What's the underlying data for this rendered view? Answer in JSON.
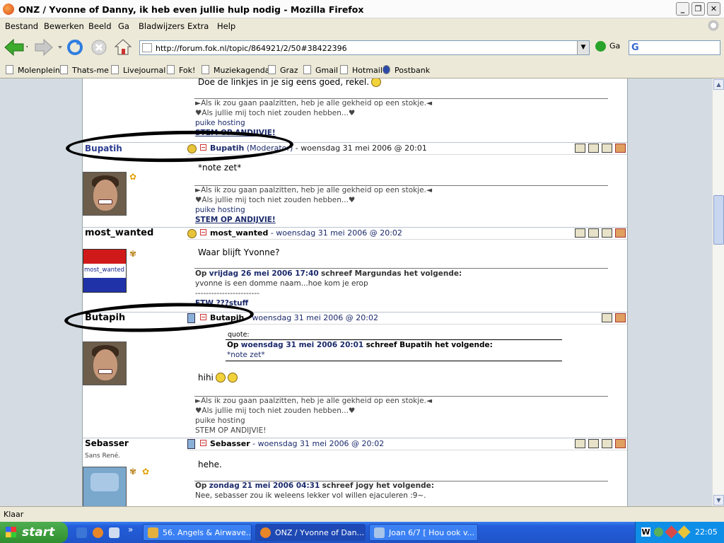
{
  "window": {
    "title": "ONZ / Yvonne of Danny, ik heb even jullie hulp nodig - Mozilla Firefox",
    "min": "_",
    "max": "❐",
    "close": "✕"
  },
  "menu": [
    "Bestand",
    "Bewerken",
    "Beeld",
    "Ga",
    "Bladwijzers",
    "Extra",
    "Help"
  ],
  "nav": {
    "url": "http://forum.fok.nl/topic/864921/2/50#38422396",
    "go_label": "Ga",
    "search_glyph": "G"
  },
  "bookmarks": [
    "Molenplein",
    "Thats-me",
    "Livejournal",
    "Fok!",
    "Muziekagenda",
    "Graz",
    "Gmail",
    "Hotmail",
    "Postbank"
  ],
  "posts": {
    "p0": {
      "body": "Doe de linkjes in je sig eens goed, rekel.",
      "sig1": "►Als ik zou gaan paalzitten, heb je alle gekheid op een stokje.◄",
      "sig2": "♥Als jullie mij toch niet zouden hebben...♥",
      "sig3": "puike hosting",
      "sig4": "STEM OP ANDIJVIE!"
    },
    "p1": {
      "user": "Bupatih",
      "header_user": "Bupatih",
      "role": "(Moderator)",
      "date": "- woensdag 31 mei 2006 @ 20:01",
      "body": "*note zet*",
      "sig1": "►Als ik zou gaan paalzitten, heb je alle gekheid op een stokje.◄",
      "sig2": "♥Als jullie mij toch niet zouden hebben...♥",
      "sig3": "puike hosting",
      "sig4": "STEM OP ANDIJVIE!"
    },
    "p2": {
      "user": "most_wanted",
      "avatar_text": "most_wanted",
      "header_user": "most_wanted",
      "date": "- woensdag 31 mei 2006 @ 20:02",
      "body": "Waar blijft Yvonne?",
      "quote_prefix": "Op",
      "quote_date": "vrijdag 26 mei 2006 17:40",
      "quote_mid": "schreef Margundas het volgende:",
      "quote_text": "yvonne is een domme naam...hoe kom je erop",
      "sig_dash": "------------------------",
      "sig_cut": "FTW ???stuff"
    },
    "p3": {
      "user": "Butapih",
      "header_user": "Butapih",
      "date": "- woensdag 31 mei 2006 @ 20:02",
      "quote_label": "quote:",
      "quote_prefix": "Op",
      "quote_date": "woensdag 31 mei 2006 20:01",
      "quote_mid": "schreef Bupatih het volgende:",
      "quote_text": "*note zet*",
      "body": "hihi",
      "sig1": "►Als ik zou gaan paalzitten, heb je alle gekheid op een stokje.◄",
      "sig2": "♥Als jullie mij toch niet zouden hebben...♥",
      "sig3": "puike hosting",
      "sig4": "STEM OP ANDIJVIE!"
    },
    "p4": {
      "user": "Sebasser",
      "subtitle": "Sans René.",
      "header_user": "Sebasser",
      "date": "- woensdag 31 mei 2006 @ 20:02",
      "body": "hehe.",
      "quote_prefix": "Op",
      "quote_date": "zondag 21 mei 2006 04:31",
      "quote_mid": "schreef jogy het volgende:",
      "quote_text": "Nee, sebasser zou ik weleens lekker vol willen ejaculeren :9~."
    }
  },
  "status": "Klaar",
  "taskbar": {
    "start": "start",
    "tasks": [
      "56. Angels & Airwave...",
      "ONZ / Yvonne of Dan...",
      "Joan 6/7 [ Hou ook v..."
    ],
    "clock": "22:05"
  }
}
